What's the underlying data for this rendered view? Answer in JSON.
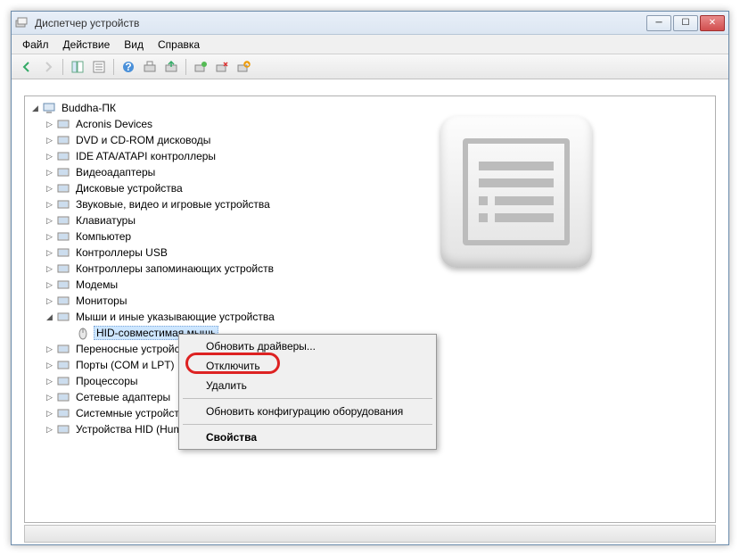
{
  "window": {
    "title": "Диспетчер устройств"
  },
  "menubar": {
    "file": "Файл",
    "action": "Действие",
    "view": "Вид",
    "help": "Справка"
  },
  "tree": {
    "root": "Buddha-ПК",
    "categories": [
      "Acronis Devices",
      "DVD и CD-ROM дисководы",
      "IDE ATA/ATAPI контроллеры",
      "Видеоадаптеры",
      "Дисковые устройства",
      "Звуковые, видео и игровые устройства",
      "Клавиатуры",
      "Компьютер",
      "Контроллеры USB",
      "Контроллеры запоминающих устройств",
      "Модемы",
      "Мониторы",
      "Мыши и иные указывающие устройства",
      "Переносные устройства",
      "Порты (COM и LPT)",
      "Процессоры",
      "Сетевые адаптеры",
      "Системные устройства",
      "Устройства HID (Human Interface Devices)"
    ],
    "selected_device": "HID-совместимая мышь"
  },
  "context_menu": {
    "update_drivers": "Обновить драйверы...",
    "disable": "Отключить",
    "delete": "Удалить",
    "scan_hardware": "Обновить конфигурацию оборудования",
    "properties": "Свойства"
  }
}
